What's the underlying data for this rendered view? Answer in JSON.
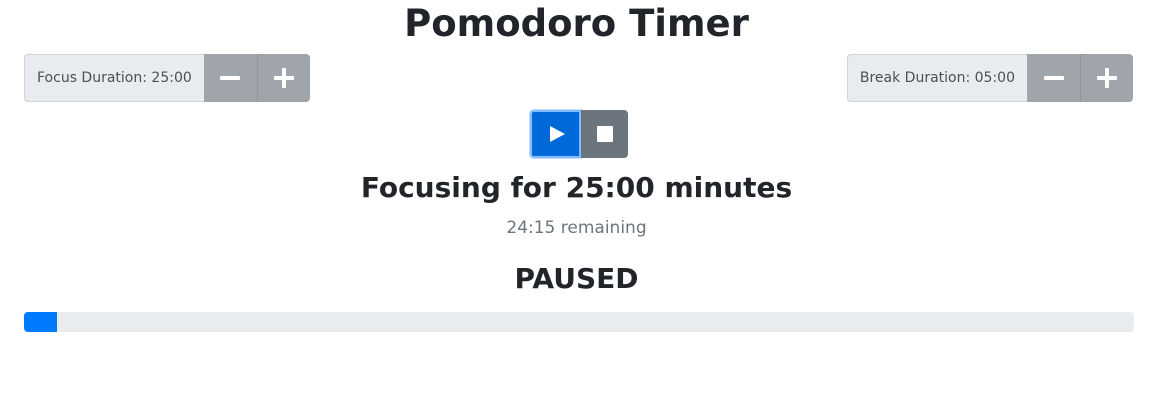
{
  "title": "Pomodoro Timer",
  "focus": {
    "label": "Focus Duration: 25:00",
    "decrement_icon": "minus-icon",
    "increment_icon": "plus-icon"
  },
  "break": {
    "label": "Break Duration: 05:00",
    "decrement_icon": "minus-icon",
    "increment_icon": "plus-icon"
  },
  "controls": {
    "play_icon": "play-icon",
    "stop_icon": "stop-icon"
  },
  "status": {
    "heading": "Focusing for 25:00 minutes",
    "remaining": "24:15 remaining",
    "state": "PAUSED"
  },
  "progress": {
    "percent": 3
  },
  "colors": {
    "primary": "#007bff",
    "primary_active": "#0069d9",
    "secondary": "#6c757d",
    "stepper": "#a0a5ac",
    "track": "#e9ecef"
  }
}
